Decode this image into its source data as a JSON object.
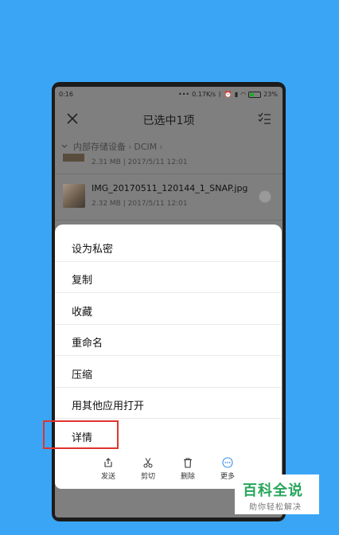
{
  "status_bar": {
    "time": "0:16",
    "network_speed": "0.17K/s",
    "battery": "23%"
  },
  "header": {
    "title": "已选中1项"
  },
  "breadcrumb": {
    "items": [
      "内部存储设备",
      "DCIM"
    ]
  },
  "files": [
    {
      "name": "",
      "size": "2.31 MB",
      "date": "2017/5/11 12:01"
    },
    {
      "name": "IMG_20170511_120144_1_SNAP.jpg",
      "size": "2.32 MB",
      "date": "2017/5/11 12:01"
    }
  ],
  "menu": {
    "items": [
      "设为私密",
      "复制",
      "收藏",
      "重命名",
      "压缩",
      "用其他应用打开",
      "详情"
    ]
  },
  "toolbar": {
    "send_label": "发送",
    "cut_label": "剪切",
    "delete_label": "删除",
    "more_label": "更多"
  },
  "watermark": {
    "title": "百科全说",
    "subtitle": "助你轻松解决"
  },
  "colors": {
    "background": "#3aa5f5",
    "highlight": "#e0342f",
    "accent": "#3a8ef0",
    "watermark_green": "#26a55a"
  }
}
